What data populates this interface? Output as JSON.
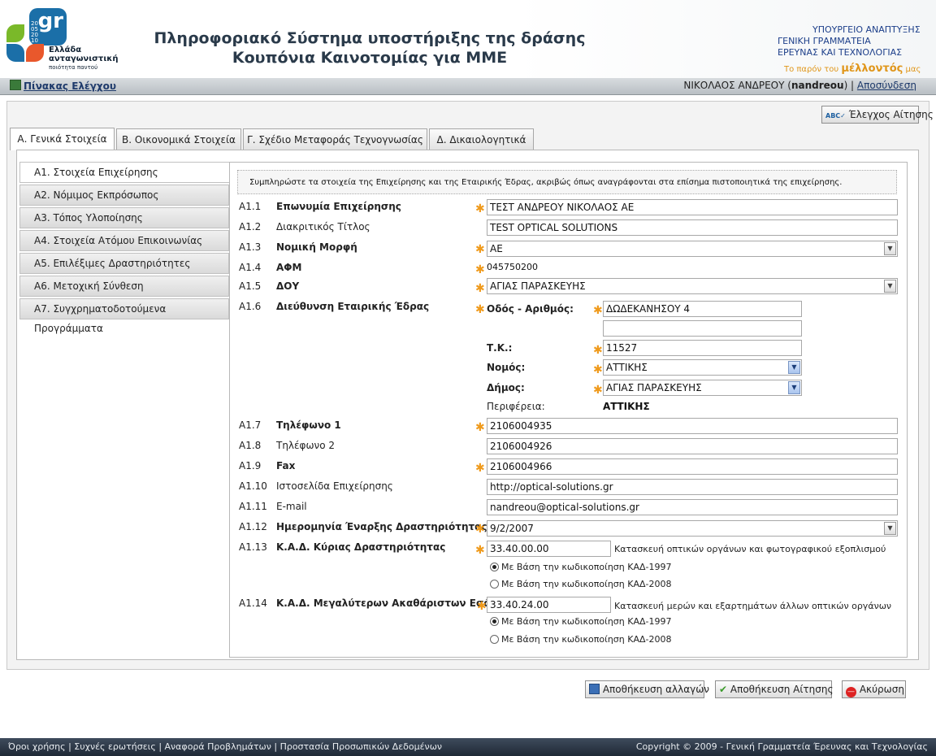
{
  "header": {
    "logo_gr": "gr",
    "logo_year": "2005 2010",
    "logo_line1": "Ελλάδα",
    "logo_line2": "ανταγωνιστική",
    "logo_line3": "ποιότητα παντού",
    "title_line1": "Πληροφοριακό Σύστημα υποστήριξης της δράσης",
    "title_line2": "Κουπόνια Καινοτομίας για ΜΜΕ",
    "ministry_line1": "ΥΠΟΥΡΓΕΙΟ ΑΝΑΠΤΥΞΗΣ",
    "ministry_line2": "ΓΕΝΙΚΗ ΓΡΑΜΜΑΤΕΙΑ",
    "ministry_line3": "ΕΡΕΥΝΑΣ ΚΑΙ ΤΕΧΝΟΛΟΓΙΑΣ",
    "motto_pre": "Το παρόν του",
    "motto_bold": "μέλλοντός",
    "motto_post": "μας"
  },
  "navbar": {
    "dashboard_label": "Πίνακας Ελέγχου",
    "user_name": "ΝΙΚΟΛΑΟΣ ΑΝΔΡΕΟΥ",
    "user_login": "nandreou",
    "logout_label": "Αποσύνδεση"
  },
  "check_button_label": "Έλεγχος Αίτησης",
  "tabs": [
    {
      "label": "Α. Γενικά Στοιχεία"
    },
    {
      "label": "Β. Οικονομικά Στοιχεία"
    },
    {
      "label": "Γ. Σχέδιο Μεταφοράς Τεχνογνωσίας"
    },
    {
      "label": "Δ. Δικαιολογητικά"
    }
  ],
  "sidebar": [
    {
      "label": "Α1. Στοιχεία Επιχείρησης"
    },
    {
      "label": "Α2. Νόμιμος Εκπρόσωπος"
    },
    {
      "label": "Α3. Τόπος Υλοποίησης"
    },
    {
      "label": "Α4. Στοιχεία Ατόμου Επικοινωνίας"
    },
    {
      "label": "Α5. Επιλέξιμες Δραστηριότητες"
    },
    {
      "label": "Α6. Μετοχική Σύνθεση"
    },
    {
      "label": "Α7. Συγχρηματοδοτούμενα Προγράμματα"
    }
  ],
  "notice": "Συμπληρώστε τα στοιχεία της Επιχείρησης και της Εταιρικής Έδρας, ακριβώς όπως αναγράφονται στα επίσημα πιστοποιητικά της επιχείρησης.",
  "fields": {
    "a1_1": {
      "num": "A1.1",
      "label": "Επωνυμία Επιχείρησης",
      "value": "ΤΕΣΤ ΑΝΔΡΕΟΥ ΝΙΚΟΛΑΟΣ ΑΕ"
    },
    "a1_2": {
      "num": "A1.2",
      "label": "Διακριτικός Τίτλος",
      "value": "TEST OPTICAL SOLUTIONS"
    },
    "a1_3": {
      "num": "A1.3",
      "label": "Νομική Μορφή",
      "value": "ΑΕ"
    },
    "a1_4": {
      "num": "A1.4",
      "label": "ΑΦΜ",
      "value": "045750200"
    },
    "a1_5": {
      "num": "A1.5",
      "label": "ΔΟΥ",
      "value": "ΑΓΙΑΣ ΠΑΡΑΣΚΕΥΗΣ"
    },
    "a1_6": {
      "num": "A1.6",
      "label": "Διεύθυνση Εταιρικής Έδρας",
      "street_label": "Οδός - Αριθμός:",
      "street_value": "ΔΩΔΕΚΑΝΗΣΟΥ 4",
      "street2_value": "",
      "zip_label": "Τ.Κ.:",
      "zip_value": "11527",
      "prefecture_label": "Νομός:",
      "prefecture_value": "ΑΤΤΙΚΗΣ",
      "municipality_label": "Δήμος:",
      "municipality_value": "ΑΓΙΑΣ ΠΑΡΑΣΚΕΥΗΣ",
      "region_label": "Περιφέρεια:",
      "region_value": "ΑΤΤΙΚΗΣ"
    },
    "a1_7": {
      "num": "A1.7",
      "label": "Τηλέφωνο 1",
      "value": "2106004935"
    },
    "a1_8": {
      "num": "A1.8",
      "label": "Τηλέφωνο 2",
      "value": "2106004926"
    },
    "a1_9": {
      "num": "A1.9",
      "label": "Fax",
      "value": "2106004966"
    },
    "a1_10": {
      "num": "A1.10",
      "label": "Ιστοσελίδα Επιχείρησης",
      "value": "http://optical-solutions.gr"
    },
    "a1_11": {
      "num": "A1.11",
      "label": "E-mail",
      "value": "nandreou@optical-solutions.gr"
    },
    "a1_12": {
      "num": "A1.12",
      "label": "Ημερομηνία Έναρξης Δραστηριότητας",
      "value": "9/2/2007"
    },
    "a1_13": {
      "num": "A1.13",
      "label": "Κ.Α.Δ. Κύριας Δραστηριότητας",
      "value": "33.40.00.00",
      "description": "Κατασκευή οπτικών οργάνων και φωτογραφικού εξοπλισμού",
      "radio1": "Με Βάση την κωδικοποίηση ΚΑΔ-1997",
      "radio2": "Με Βάση την κωδικοποίηση ΚΑΔ-2008"
    },
    "a1_14": {
      "num": "A1.14",
      "label": "Κ.Α.Δ. Μεγαλύτερων Ακαθάριστων Εσόδων",
      "value": "33.40.24.00",
      "description": "Κατασκευή μερών και εξαρτημάτων άλλων οπτικών οργάνων",
      "radio1": "Με Βάση την κωδικοποίηση ΚΑΔ-1997",
      "radio2": "Με Βάση την κωδικοποίηση ΚΑΔ-2008"
    }
  },
  "buttons": {
    "save_changes": "Αποθήκευση αλλαγών",
    "save_application": "Αποθήκευση Αίτησης",
    "cancel": "Ακύρωση"
  },
  "footer": {
    "links": "Όροι χρήσης |  Συχνές ερωτήσεις |  Αναφορά Προβλημάτων |  Προστασία Προσωπικών Δεδομένων",
    "copyright": "Copyright © 2009 - Γενική Γραμματεία Έρευνας και Τεχνολογίας"
  },
  "colors": {
    "required_star": "#ef9a1c",
    "link": "#1e3a6b",
    "footer_bg": "#2a3544"
  }
}
